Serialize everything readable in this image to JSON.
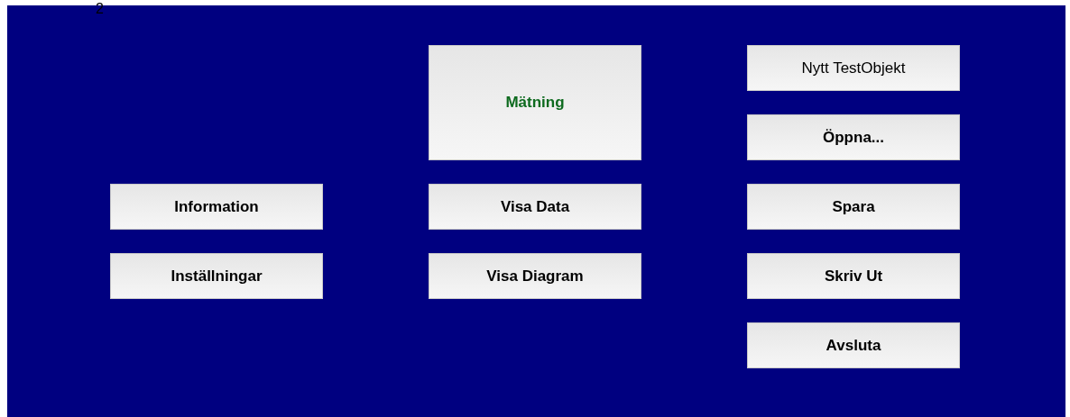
{
  "page_number": "2",
  "columns": [
    {
      "buttons": [
        {
          "label": "Information",
          "kind": "bold"
        },
        {
          "label": "Inställningar",
          "kind": "bold"
        }
      ]
    },
    {
      "buttons": [
        {
          "label": "Mätning",
          "kind": "large"
        },
        {
          "label": "Visa Data",
          "kind": "bold"
        },
        {
          "label": "Visa Diagram",
          "kind": "bold"
        }
      ]
    },
    {
      "buttons": [
        {
          "label": "Nytt TestObjekt",
          "kind": "plain"
        },
        {
          "label": "Öppna...",
          "kind": "bold"
        },
        {
          "label": "Spara",
          "kind": "bold"
        },
        {
          "label": "Skriv Ut",
          "kind": "bold"
        },
        {
          "label": "Avsluta",
          "kind": "bold"
        }
      ]
    }
  ]
}
